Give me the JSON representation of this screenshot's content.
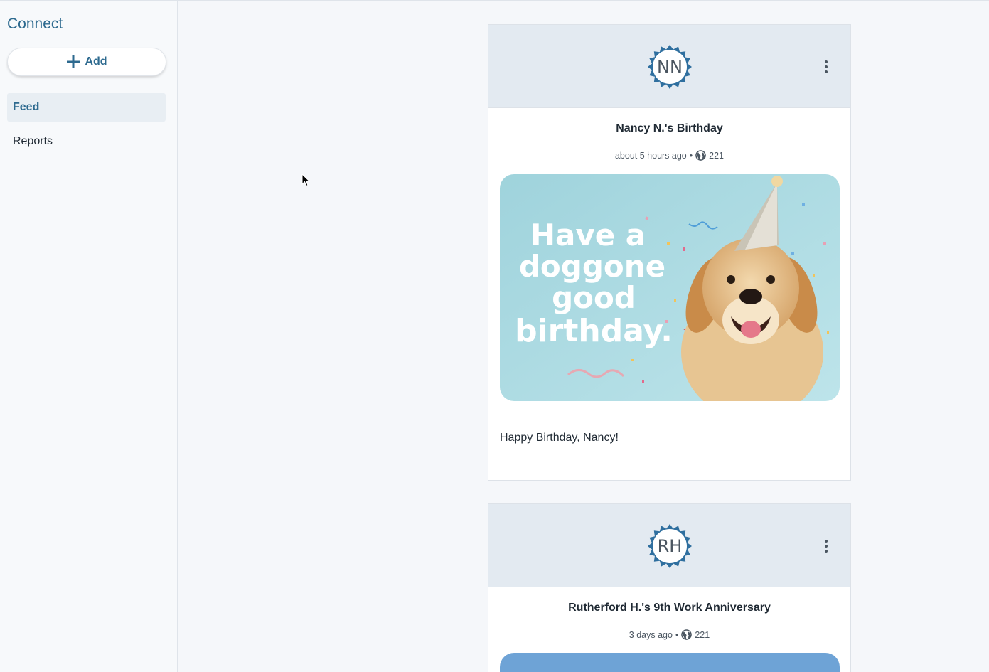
{
  "sidebar": {
    "app_title": "Connect",
    "add_label": "Add",
    "nav": [
      {
        "label": "Feed",
        "active": true
      },
      {
        "label": "Reports",
        "active": false
      }
    ]
  },
  "feed": {
    "posts": [
      {
        "initials": "NN",
        "title": "Nancy N.'s Birthday",
        "time": "about 5 hours ago",
        "separator": "•",
        "views": "221",
        "image_text": [
          "Have a",
          "doggone",
          "good",
          "birthday."
        ],
        "message": "Happy Birthday, Nancy!"
      },
      {
        "initials": "RH",
        "title": "Rutherford H.'s 9th Work Anniversary",
        "time": "3 days ago",
        "separator": "•",
        "views": "221"
      }
    ]
  },
  "colors": {
    "accent": "#2d6a8f",
    "badge": "#2f6f9f",
    "header_bg": "#e3eaf1",
    "card_image_bg": "#aedbe3",
    "anniversary_image": "#6ea3d6"
  },
  "icons": {
    "add": "plus-icon",
    "menu": "kebab-menu-icon",
    "visibility": "globe-icon",
    "badge": "starburst-badge-icon"
  }
}
